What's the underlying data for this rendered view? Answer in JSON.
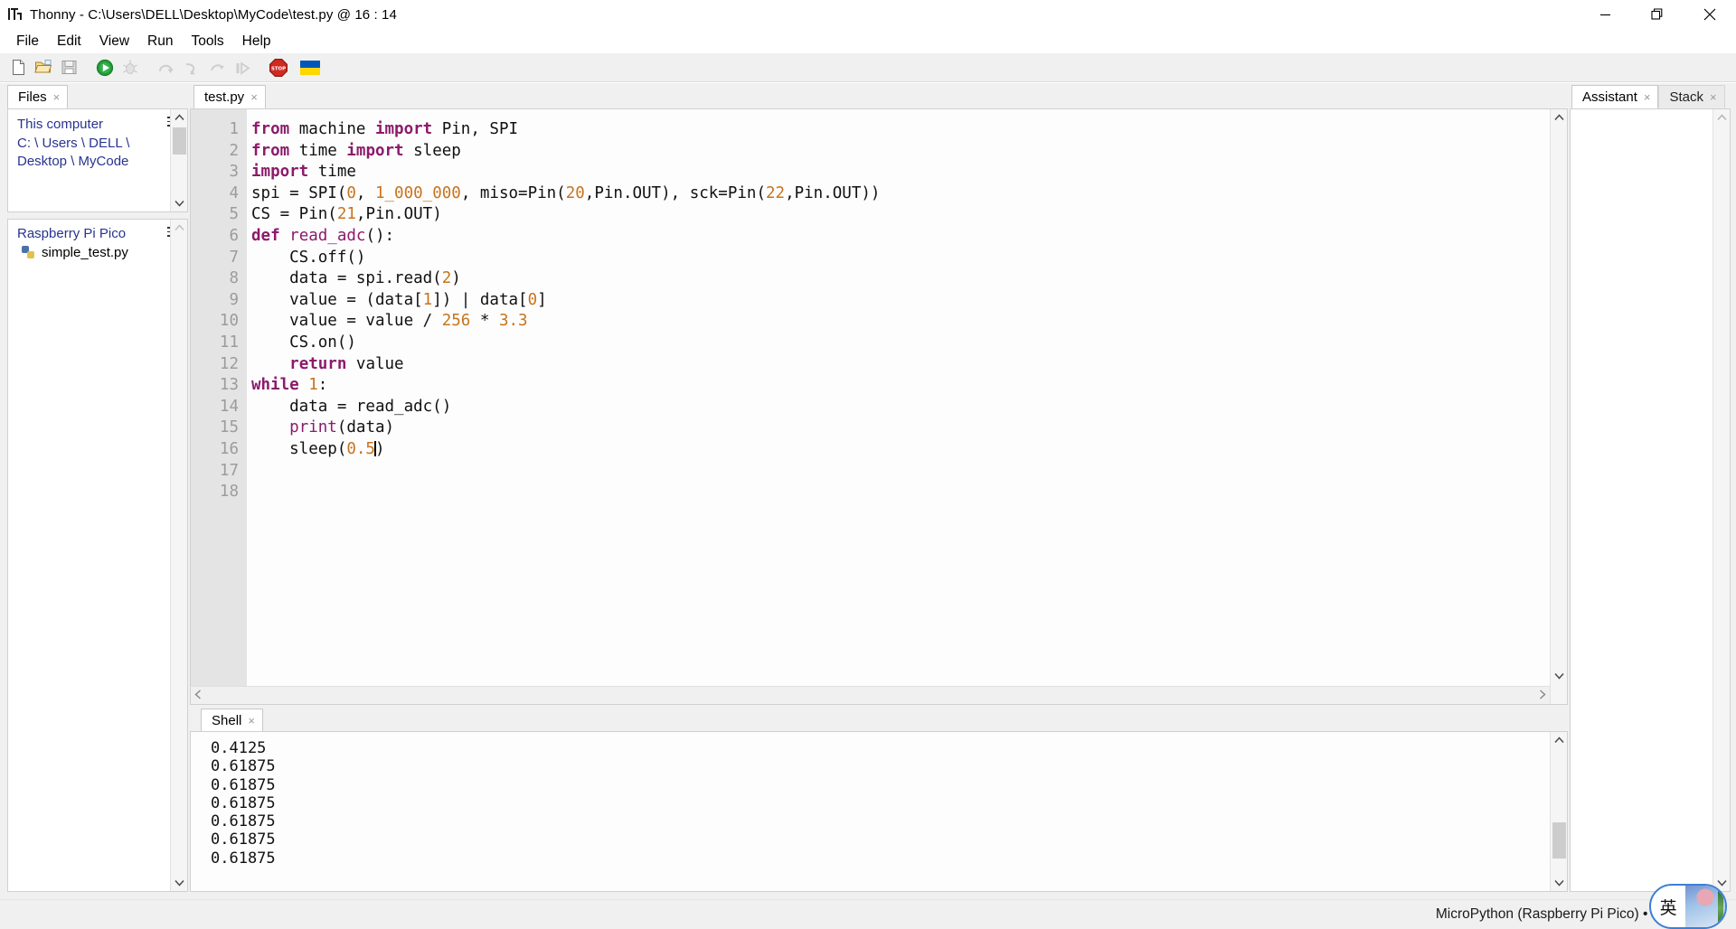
{
  "window": {
    "title": "Thonny  -  C:\\Users\\DELL\\Desktop\\MyCode\\test.py  @  16 : 14",
    "app_icon": "thonny-icon",
    "minimize_label": "–",
    "maximize_label": "❐",
    "close_label": "✕"
  },
  "menubar": {
    "items": [
      {
        "label": "File"
      },
      {
        "label": "Edit"
      },
      {
        "label": "View"
      },
      {
        "label": "Run"
      },
      {
        "label": "Tools"
      },
      {
        "label": "Help"
      }
    ]
  },
  "toolbar": {
    "buttons": [
      {
        "name": "new-file-icon",
        "label": "New"
      },
      {
        "name": "open-file-icon",
        "label": "Open"
      },
      {
        "name": "save-file-icon",
        "label": "Save"
      },
      {
        "name": "run-icon",
        "label": "Run current script"
      },
      {
        "name": "debug-icon",
        "label": "Debug current script"
      },
      {
        "name": "step-over-icon",
        "label": "Step over"
      },
      {
        "name": "step-into-icon",
        "label": "Step into"
      },
      {
        "name": "step-out-icon",
        "label": "Step out"
      },
      {
        "name": "resume-icon",
        "label": "Resume"
      },
      {
        "name": "stop-icon",
        "label": "Stop/Restart backend"
      },
      {
        "name": "ukraine-flag-icon",
        "label": "Support Ukraine"
      }
    ]
  },
  "files_panel": {
    "tab": {
      "label": "Files",
      "close": "×"
    },
    "this_computer": {
      "title": "This computer",
      "path_line1": "C: \\ Users \\ DELL \\",
      "path_line2": "Desktop \\ MyCode",
      "menu_icon": "hamburger-icon"
    },
    "device": {
      "title": "Raspberry Pi Pico",
      "menu_icon": "hamburger-icon",
      "files": [
        {
          "name": "simple_test.py",
          "icon": "python-file-icon"
        }
      ]
    }
  },
  "editor": {
    "tab": {
      "label": "test.py",
      "close": "×"
    },
    "line_numbers": [
      "1",
      "2",
      "3",
      "4",
      "5",
      "6",
      "7",
      "8",
      "9",
      "10",
      "11",
      "12",
      "13",
      "14",
      "15",
      "16",
      "17",
      "18"
    ],
    "lines": [
      "from machine import Pin, SPI",
      "from time import sleep",
      "import time",
      "spi = SPI(0, 1_000_000, miso=Pin(20,Pin.OUT), sck=Pin(22,Pin.OUT))",
      "CS = Pin(21,Pin.OUT)",
      "def read_adc():",
      "    CS.off()",
      "    data = spi.read(2)",
      "    value = (data[1]) | data[0]",
      "    value = value / 256 * 3.3",
      "    CS.on()",
      "    return value",
      "while 1:",
      "    data = read_adc()",
      "    print(data)",
      "    sleep(0.5)",
      "",
      ""
    ],
    "cursor_line": 16,
    "cursor_col": 14
  },
  "shell": {
    "tab": {
      "label": "Shell",
      "close": "×"
    },
    "output": [
      "0.4125",
      "0.61875",
      "0.61875",
      "0.61875",
      "0.61875",
      "0.61875",
      "0.61875"
    ]
  },
  "right_panel": {
    "tabs": [
      {
        "label": "Assistant",
        "close": "×",
        "active": true
      },
      {
        "label": "Stack",
        "close": "×",
        "active": false
      }
    ]
  },
  "statusbar": {
    "text": "MicroPython (Raspberry Pi Pico)  •  Board CDC"
  },
  "ime": {
    "mode": "英"
  },
  "colors": {
    "keyword": "#8c1a6b",
    "number": "#c8731c",
    "link": "#27348f",
    "toolbar_bg": "#f0f0f0",
    "editor_bg": "#fdfdfd",
    "gutter_bg": "#e4e4e4"
  }
}
